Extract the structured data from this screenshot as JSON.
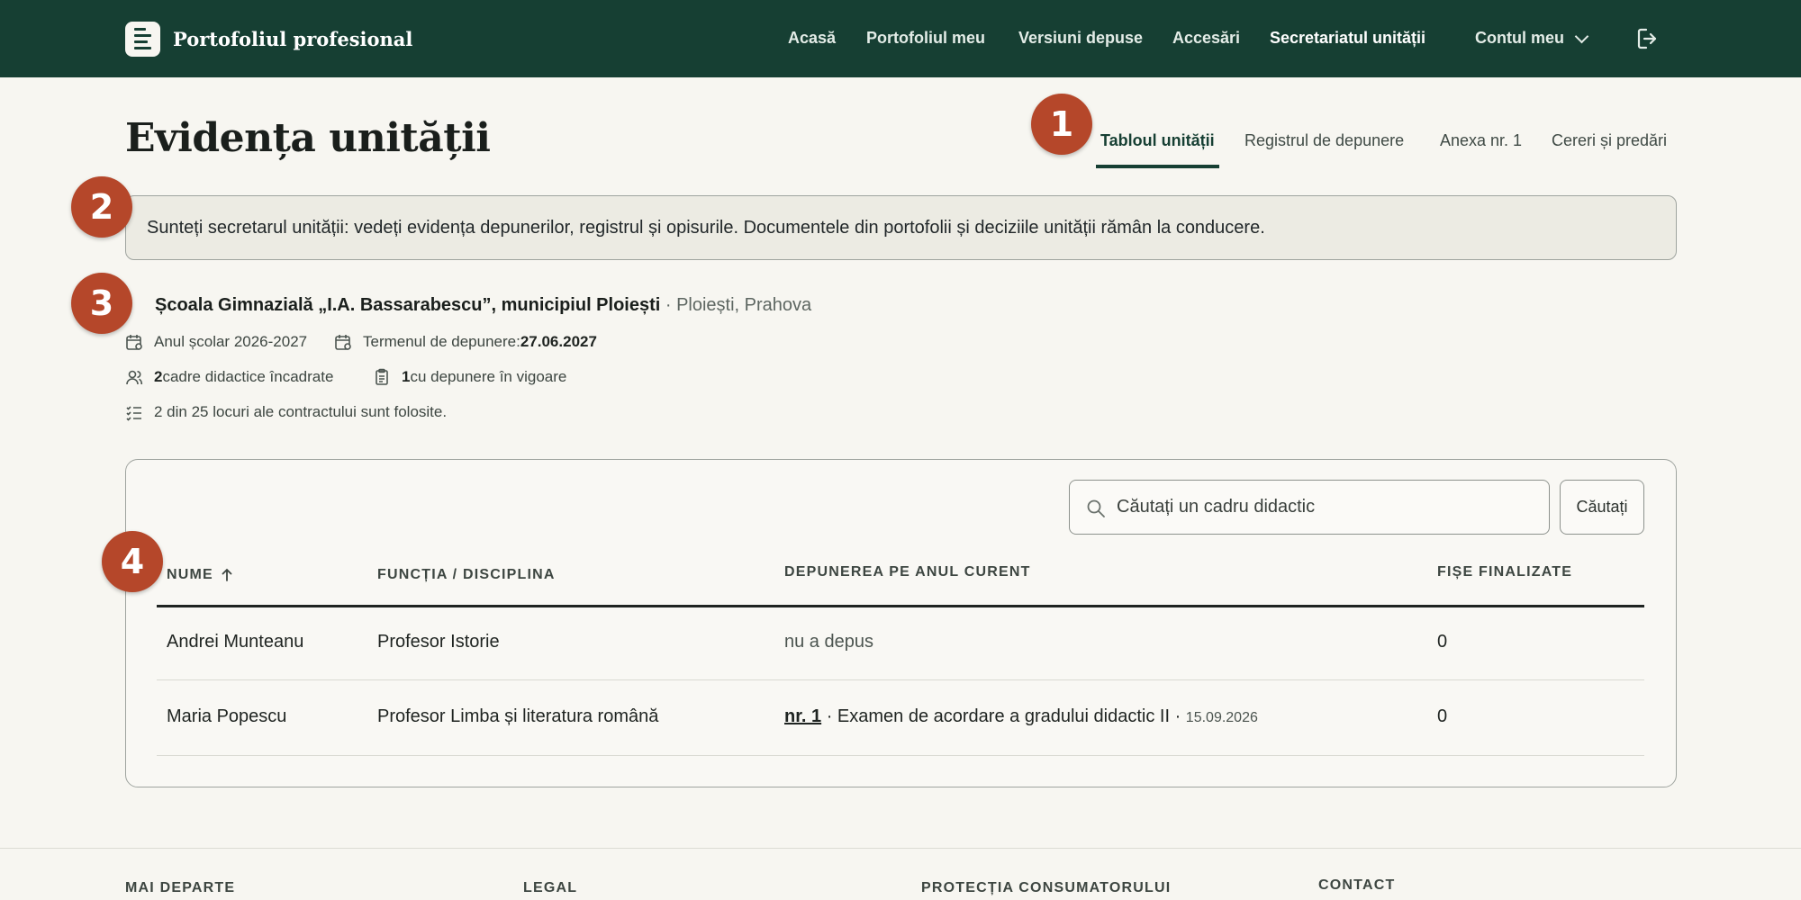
{
  "brand": {
    "name": "Portofoliul profesional"
  },
  "nav": {
    "items": [
      "Acasă",
      "Portofoliul meu",
      "Versiuni depuse",
      "Accesări",
      "Secretariatul unității"
    ],
    "account": "Contul meu"
  },
  "page": {
    "title": "Evidența unității"
  },
  "tabs": [
    "Tabloul unității",
    "Registrul de depunere",
    "Anexa nr. 1",
    "Cereri și predări"
  ],
  "annotations": [
    "1",
    "2",
    "3",
    "4"
  ],
  "notice": "Sunteți secretarul unității: vedeți evidența depunerilor, registrul și opisurile. Documentele din portofolii și deciziile unității rămân la conducere.",
  "unit": {
    "name": "Școala Gimnazială „I.A. Bassarabescu”, municipiul Ploiești",
    "location": " · Ploiești, Prahova",
    "school_year": "Anul școlar 2026-2027",
    "deadline_label": "Termenul de depunere: ",
    "deadline_value": "27.06.2027",
    "staff_count": "2",
    "staff_label": " cadre didactice încadrate",
    "active_count": "1",
    "active_label": " cu depunere în vigoare",
    "contract_usage": "2 din 25 locuri ale contractului sunt folosite."
  },
  "search": {
    "placeholder": "Căutați un cadru didactic",
    "button": "Căutați"
  },
  "table": {
    "headers": [
      "Nume",
      "Funcția / Disciplina",
      "Depunerea pe anul curent",
      "Fișe finalizate"
    ],
    "rows": [
      {
        "name": "Andrei Munteanu",
        "role": "Profesor Istorie",
        "deposit_status": "nu a depus",
        "finalized": "0"
      },
      {
        "name": "Maria Popescu",
        "role": "Profesor Limba și literatura română",
        "deposit_link": "nr. 1",
        "deposit_desc": " · Examen de acordare a gradului didactic II · ",
        "deposit_date": "15.09.2026",
        "finalized": "0"
      }
    ]
  },
  "footer": {
    "headings": [
      "Mai departe",
      "Legal",
      "Protecția consumatorului",
      "Contact"
    ]
  },
  "colors": {
    "header_bg": "#163f33",
    "badge": "#b5472a",
    "page_bg": "#f7f6f1"
  }
}
